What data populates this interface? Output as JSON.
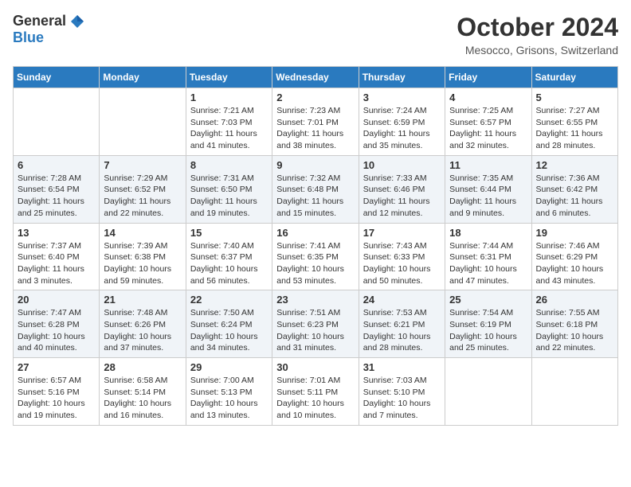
{
  "logo": {
    "general": "General",
    "blue": "Blue"
  },
  "title": "October 2024",
  "location": "Mesocco, Grisons, Switzerland",
  "days_of_week": [
    "Sunday",
    "Monday",
    "Tuesday",
    "Wednesday",
    "Thursday",
    "Friday",
    "Saturday"
  ],
  "weeks": [
    [
      {
        "day": "",
        "sunrise": "",
        "sunset": "",
        "daylight": ""
      },
      {
        "day": "",
        "sunrise": "",
        "sunset": "",
        "daylight": ""
      },
      {
        "day": "1",
        "sunrise": "Sunrise: 7:21 AM",
        "sunset": "Sunset: 7:03 PM",
        "daylight": "Daylight: 11 hours and 41 minutes."
      },
      {
        "day": "2",
        "sunrise": "Sunrise: 7:23 AM",
        "sunset": "Sunset: 7:01 PM",
        "daylight": "Daylight: 11 hours and 38 minutes."
      },
      {
        "day": "3",
        "sunrise": "Sunrise: 7:24 AM",
        "sunset": "Sunset: 6:59 PM",
        "daylight": "Daylight: 11 hours and 35 minutes."
      },
      {
        "day": "4",
        "sunrise": "Sunrise: 7:25 AM",
        "sunset": "Sunset: 6:57 PM",
        "daylight": "Daylight: 11 hours and 32 minutes."
      },
      {
        "day": "5",
        "sunrise": "Sunrise: 7:27 AM",
        "sunset": "Sunset: 6:55 PM",
        "daylight": "Daylight: 11 hours and 28 minutes."
      }
    ],
    [
      {
        "day": "6",
        "sunrise": "Sunrise: 7:28 AM",
        "sunset": "Sunset: 6:54 PM",
        "daylight": "Daylight: 11 hours and 25 minutes."
      },
      {
        "day": "7",
        "sunrise": "Sunrise: 7:29 AM",
        "sunset": "Sunset: 6:52 PM",
        "daylight": "Daylight: 11 hours and 22 minutes."
      },
      {
        "day": "8",
        "sunrise": "Sunrise: 7:31 AM",
        "sunset": "Sunset: 6:50 PM",
        "daylight": "Daylight: 11 hours and 19 minutes."
      },
      {
        "day": "9",
        "sunrise": "Sunrise: 7:32 AM",
        "sunset": "Sunset: 6:48 PM",
        "daylight": "Daylight: 11 hours and 15 minutes."
      },
      {
        "day": "10",
        "sunrise": "Sunrise: 7:33 AM",
        "sunset": "Sunset: 6:46 PM",
        "daylight": "Daylight: 11 hours and 12 minutes."
      },
      {
        "day": "11",
        "sunrise": "Sunrise: 7:35 AM",
        "sunset": "Sunset: 6:44 PM",
        "daylight": "Daylight: 11 hours and 9 minutes."
      },
      {
        "day": "12",
        "sunrise": "Sunrise: 7:36 AM",
        "sunset": "Sunset: 6:42 PM",
        "daylight": "Daylight: 11 hours and 6 minutes."
      }
    ],
    [
      {
        "day": "13",
        "sunrise": "Sunrise: 7:37 AM",
        "sunset": "Sunset: 6:40 PM",
        "daylight": "Daylight: 11 hours and 3 minutes."
      },
      {
        "day": "14",
        "sunrise": "Sunrise: 7:39 AM",
        "sunset": "Sunset: 6:38 PM",
        "daylight": "Daylight: 10 hours and 59 minutes."
      },
      {
        "day": "15",
        "sunrise": "Sunrise: 7:40 AM",
        "sunset": "Sunset: 6:37 PM",
        "daylight": "Daylight: 10 hours and 56 minutes."
      },
      {
        "day": "16",
        "sunrise": "Sunrise: 7:41 AM",
        "sunset": "Sunset: 6:35 PM",
        "daylight": "Daylight: 10 hours and 53 minutes."
      },
      {
        "day": "17",
        "sunrise": "Sunrise: 7:43 AM",
        "sunset": "Sunset: 6:33 PM",
        "daylight": "Daylight: 10 hours and 50 minutes."
      },
      {
        "day": "18",
        "sunrise": "Sunrise: 7:44 AM",
        "sunset": "Sunset: 6:31 PM",
        "daylight": "Daylight: 10 hours and 47 minutes."
      },
      {
        "day": "19",
        "sunrise": "Sunrise: 7:46 AM",
        "sunset": "Sunset: 6:29 PM",
        "daylight": "Daylight: 10 hours and 43 minutes."
      }
    ],
    [
      {
        "day": "20",
        "sunrise": "Sunrise: 7:47 AM",
        "sunset": "Sunset: 6:28 PM",
        "daylight": "Daylight: 10 hours and 40 minutes."
      },
      {
        "day": "21",
        "sunrise": "Sunrise: 7:48 AM",
        "sunset": "Sunset: 6:26 PM",
        "daylight": "Daylight: 10 hours and 37 minutes."
      },
      {
        "day": "22",
        "sunrise": "Sunrise: 7:50 AM",
        "sunset": "Sunset: 6:24 PM",
        "daylight": "Daylight: 10 hours and 34 minutes."
      },
      {
        "day": "23",
        "sunrise": "Sunrise: 7:51 AM",
        "sunset": "Sunset: 6:23 PM",
        "daylight": "Daylight: 10 hours and 31 minutes."
      },
      {
        "day": "24",
        "sunrise": "Sunrise: 7:53 AM",
        "sunset": "Sunset: 6:21 PM",
        "daylight": "Daylight: 10 hours and 28 minutes."
      },
      {
        "day": "25",
        "sunrise": "Sunrise: 7:54 AM",
        "sunset": "Sunset: 6:19 PM",
        "daylight": "Daylight: 10 hours and 25 minutes."
      },
      {
        "day": "26",
        "sunrise": "Sunrise: 7:55 AM",
        "sunset": "Sunset: 6:18 PM",
        "daylight": "Daylight: 10 hours and 22 minutes."
      }
    ],
    [
      {
        "day": "27",
        "sunrise": "Sunrise: 6:57 AM",
        "sunset": "Sunset: 5:16 PM",
        "daylight": "Daylight: 10 hours and 19 minutes."
      },
      {
        "day": "28",
        "sunrise": "Sunrise: 6:58 AM",
        "sunset": "Sunset: 5:14 PM",
        "daylight": "Daylight: 10 hours and 16 minutes."
      },
      {
        "day": "29",
        "sunrise": "Sunrise: 7:00 AM",
        "sunset": "Sunset: 5:13 PM",
        "daylight": "Daylight: 10 hours and 13 minutes."
      },
      {
        "day": "30",
        "sunrise": "Sunrise: 7:01 AM",
        "sunset": "Sunset: 5:11 PM",
        "daylight": "Daylight: 10 hours and 10 minutes."
      },
      {
        "day": "31",
        "sunrise": "Sunrise: 7:03 AM",
        "sunset": "Sunset: 5:10 PM",
        "daylight": "Daylight: 10 hours and 7 minutes."
      },
      {
        "day": "",
        "sunrise": "",
        "sunset": "",
        "daylight": ""
      },
      {
        "day": "",
        "sunrise": "",
        "sunset": "",
        "daylight": ""
      }
    ]
  ]
}
